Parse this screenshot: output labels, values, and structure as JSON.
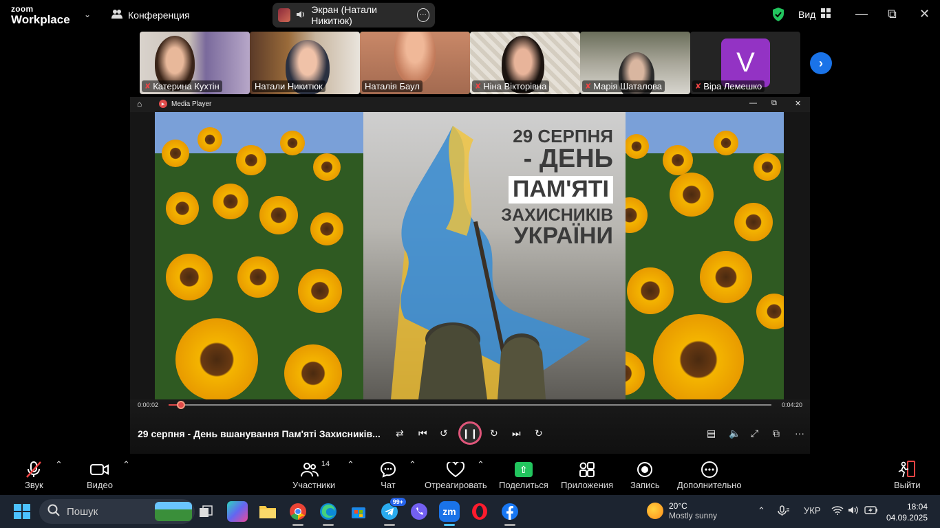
{
  "zoom": {
    "logo_line1": "zoom",
    "logo_line2": "Workplace",
    "meeting_label": "Конференция",
    "screen_share_label": "Экран (Натали Никитюк)",
    "view_label": "Вид"
  },
  "participants": [
    {
      "name": "Катерина Кухтін",
      "muted": true
    },
    {
      "name": "Натали Никитюк",
      "muted": false
    },
    {
      "name": "Наталія Баул",
      "muted": false,
      "active_speaker": true
    },
    {
      "name": "Ніна Вікторівна",
      "muted": true
    },
    {
      "name": "Марія Шаталова",
      "muted": true
    },
    {
      "name": "Віра Лемешко",
      "muted": true,
      "avatar_letter": "V",
      "avatar_color": "#9333c4"
    }
  ],
  "media_player": {
    "window_title": "Media Player",
    "poster_line1": "29 СЕРПНЯ",
    "poster_line2": "- ДЕНЬ",
    "poster_line3": "ПАМ'ЯТІ",
    "poster_line4": "ЗАХИСНИКІВ",
    "poster_line5": "УКРАЇНИ",
    "time_elapsed": "0:00:02",
    "time_total": "0:04:20",
    "progress_fraction": 0.016,
    "media_title": "29 серпня - День вшанування Пам'яті Захисників...",
    "accent_color": "#e04b4b"
  },
  "toolbar": {
    "audio": "Звук",
    "video": "Видео",
    "participants": "Участники",
    "participants_count": "14",
    "chat": "Чат",
    "react": "Отреагировать",
    "share": "Поделиться",
    "apps": "Приложения",
    "record": "Запись",
    "more": "Дополнительно",
    "leave": "Выйти"
  },
  "taskbar": {
    "search_placeholder": "Пошук",
    "telegram_badge": "99+",
    "zoom_app_label": "zm",
    "weather_temp": "20°C",
    "weather_desc": "Mostly sunny",
    "language": "УКР",
    "time": "18:04",
    "date": "04.09.2025"
  }
}
